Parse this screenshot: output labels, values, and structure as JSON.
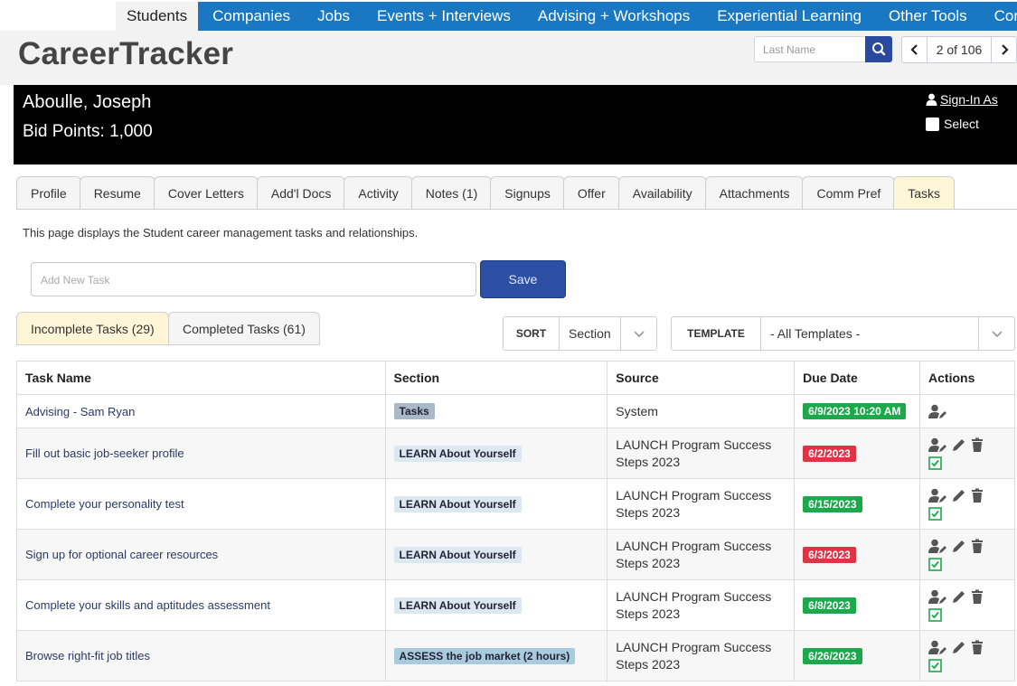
{
  "nav": {
    "items": [
      "Students",
      "Companies",
      "Jobs",
      "Events + Interviews",
      "Advising + Workshops",
      "Experiential Learning",
      "Other Tools",
      "Configu"
    ],
    "active_index": 0
  },
  "header": {
    "brand": "CareerTracker",
    "search_placeholder": "Last Name",
    "pager": "2 of 106"
  },
  "student": {
    "name": "Aboulle, Joseph",
    "bid_points": "Bid Points: 1,000",
    "sign_in_as": "Sign-In As",
    "select_label": "Select"
  },
  "tabs": [
    "Profile",
    "Resume",
    "Cover Letters",
    "Add'l Docs",
    "Activity",
    "Notes (1)",
    "Signups",
    "Offer",
    "Availability",
    "Attachments",
    "Comm Pref",
    "Tasks"
  ],
  "active_tab_index": 11,
  "description": "This page displays the Student career management tasks and relationships.",
  "new_task": {
    "placeholder": "Add New Task",
    "save_label": "Save"
  },
  "subtabs": {
    "incomplete": "Incomplete Tasks (29)",
    "completed": "Completed Tasks (61)"
  },
  "sort": {
    "label": "SORT",
    "value": "Section"
  },
  "template": {
    "label": "TEMPLATE",
    "value": "- All Templates -"
  },
  "table": {
    "headers": [
      "Task Name",
      "Section",
      "Source",
      "Due Date",
      "Actions"
    ],
    "rows": [
      {
        "task": "Advising - Sam Ryan",
        "section": "Tasks",
        "section_style": "dark",
        "source_line1": "System",
        "source_line2": "",
        "due": "6/9/2023 10:20 AM",
        "due_status": "green",
        "actions": "assign-only"
      },
      {
        "task": "Fill out basic job-seeker profile",
        "section": "LEARN About Yourself",
        "section_style": "light",
        "source_line1": "LAUNCH Program Success",
        "source_line2": "Steps 2023",
        "due": "6/2/2023",
        "due_status": "red",
        "actions": "full"
      },
      {
        "task": "Complete your personality test",
        "section": "LEARN About Yourself",
        "section_style": "light",
        "source_line1": "LAUNCH Program Success",
        "source_line2": "Steps 2023",
        "due": "6/15/2023",
        "due_status": "green",
        "actions": "full"
      },
      {
        "task": "Sign up for optional career resources",
        "section": "LEARN About Yourself",
        "section_style": "light",
        "source_line1": "LAUNCH Program Success",
        "source_line2": "Steps 2023",
        "due": "6/3/2023",
        "due_status": "red",
        "actions": "full"
      },
      {
        "task": "Complete your skills and aptitudes assessment",
        "section": "LEARN About Yourself",
        "section_style": "light",
        "source_line1": "LAUNCH Program Success",
        "source_line2": "Steps 2023",
        "due": "6/8/2023",
        "due_status": "green",
        "actions": "full"
      },
      {
        "task": "Browse right-fit job titles",
        "section": "ASSESS the job market (2 hours)",
        "section_style": "assess",
        "source_line1": "LAUNCH Program Success",
        "source_line2": "Steps 2023",
        "due": "6/26/2023",
        "due_status": "green",
        "actions": "full"
      }
    ]
  },
  "colors": {
    "nav_bg": "#1a78c2",
    "save_bg": "#2c4ea3",
    "due_green": "#1ca84b",
    "due_red": "#dc3545",
    "active_tab": "#fff6d8"
  },
  "icons": {
    "search": "search-icon",
    "prev": "chevron-left-icon",
    "next": "chevron-right-icon",
    "user": "user-icon",
    "assign": "user-edit-icon",
    "edit": "pencil-icon",
    "delete": "trash-icon",
    "complete": "check-square-icon",
    "dropdown": "chevron-down-icon"
  }
}
